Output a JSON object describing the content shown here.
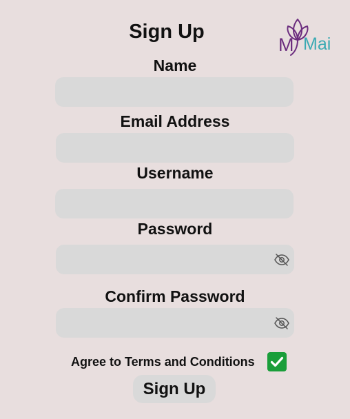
{
  "page": {
    "title": "Sign Up"
  },
  "logo": {
    "text": "MyMai",
    "icon": "lotus-icon",
    "colors": {
      "purple": "#6b2c7e",
      "teal": "#3aaab3"
    }
  },
  "fields": {
    "name": {
      "label": "Name",
      "value": ""
    },
    "email": {
      "label": "Email Address",
      "value": ""
    },
    "username": {
      "label": "Username",
      "value": ""
    },
    "password": {
      "label": "Password",
      "value": "",
      "icon": "eye-slash-icon"
    },
    "confirm_password": {
      "label": "Confirm Password",
      "value": "",
      "icon": "eye-slash-icon"
    }
  },
  "terms": {
    "label": "Agree to Terms and Conditions",
    "checked": true,
    "icon": "checkmark-icon"
  },
  "submit": {
    "label": "Sign Up"
  },
  "colors": {
    "background": "#e8dede",
    "field_background": "#d9d9d9",
    "checkbox_green": "#1a9e3a"
  }
}
